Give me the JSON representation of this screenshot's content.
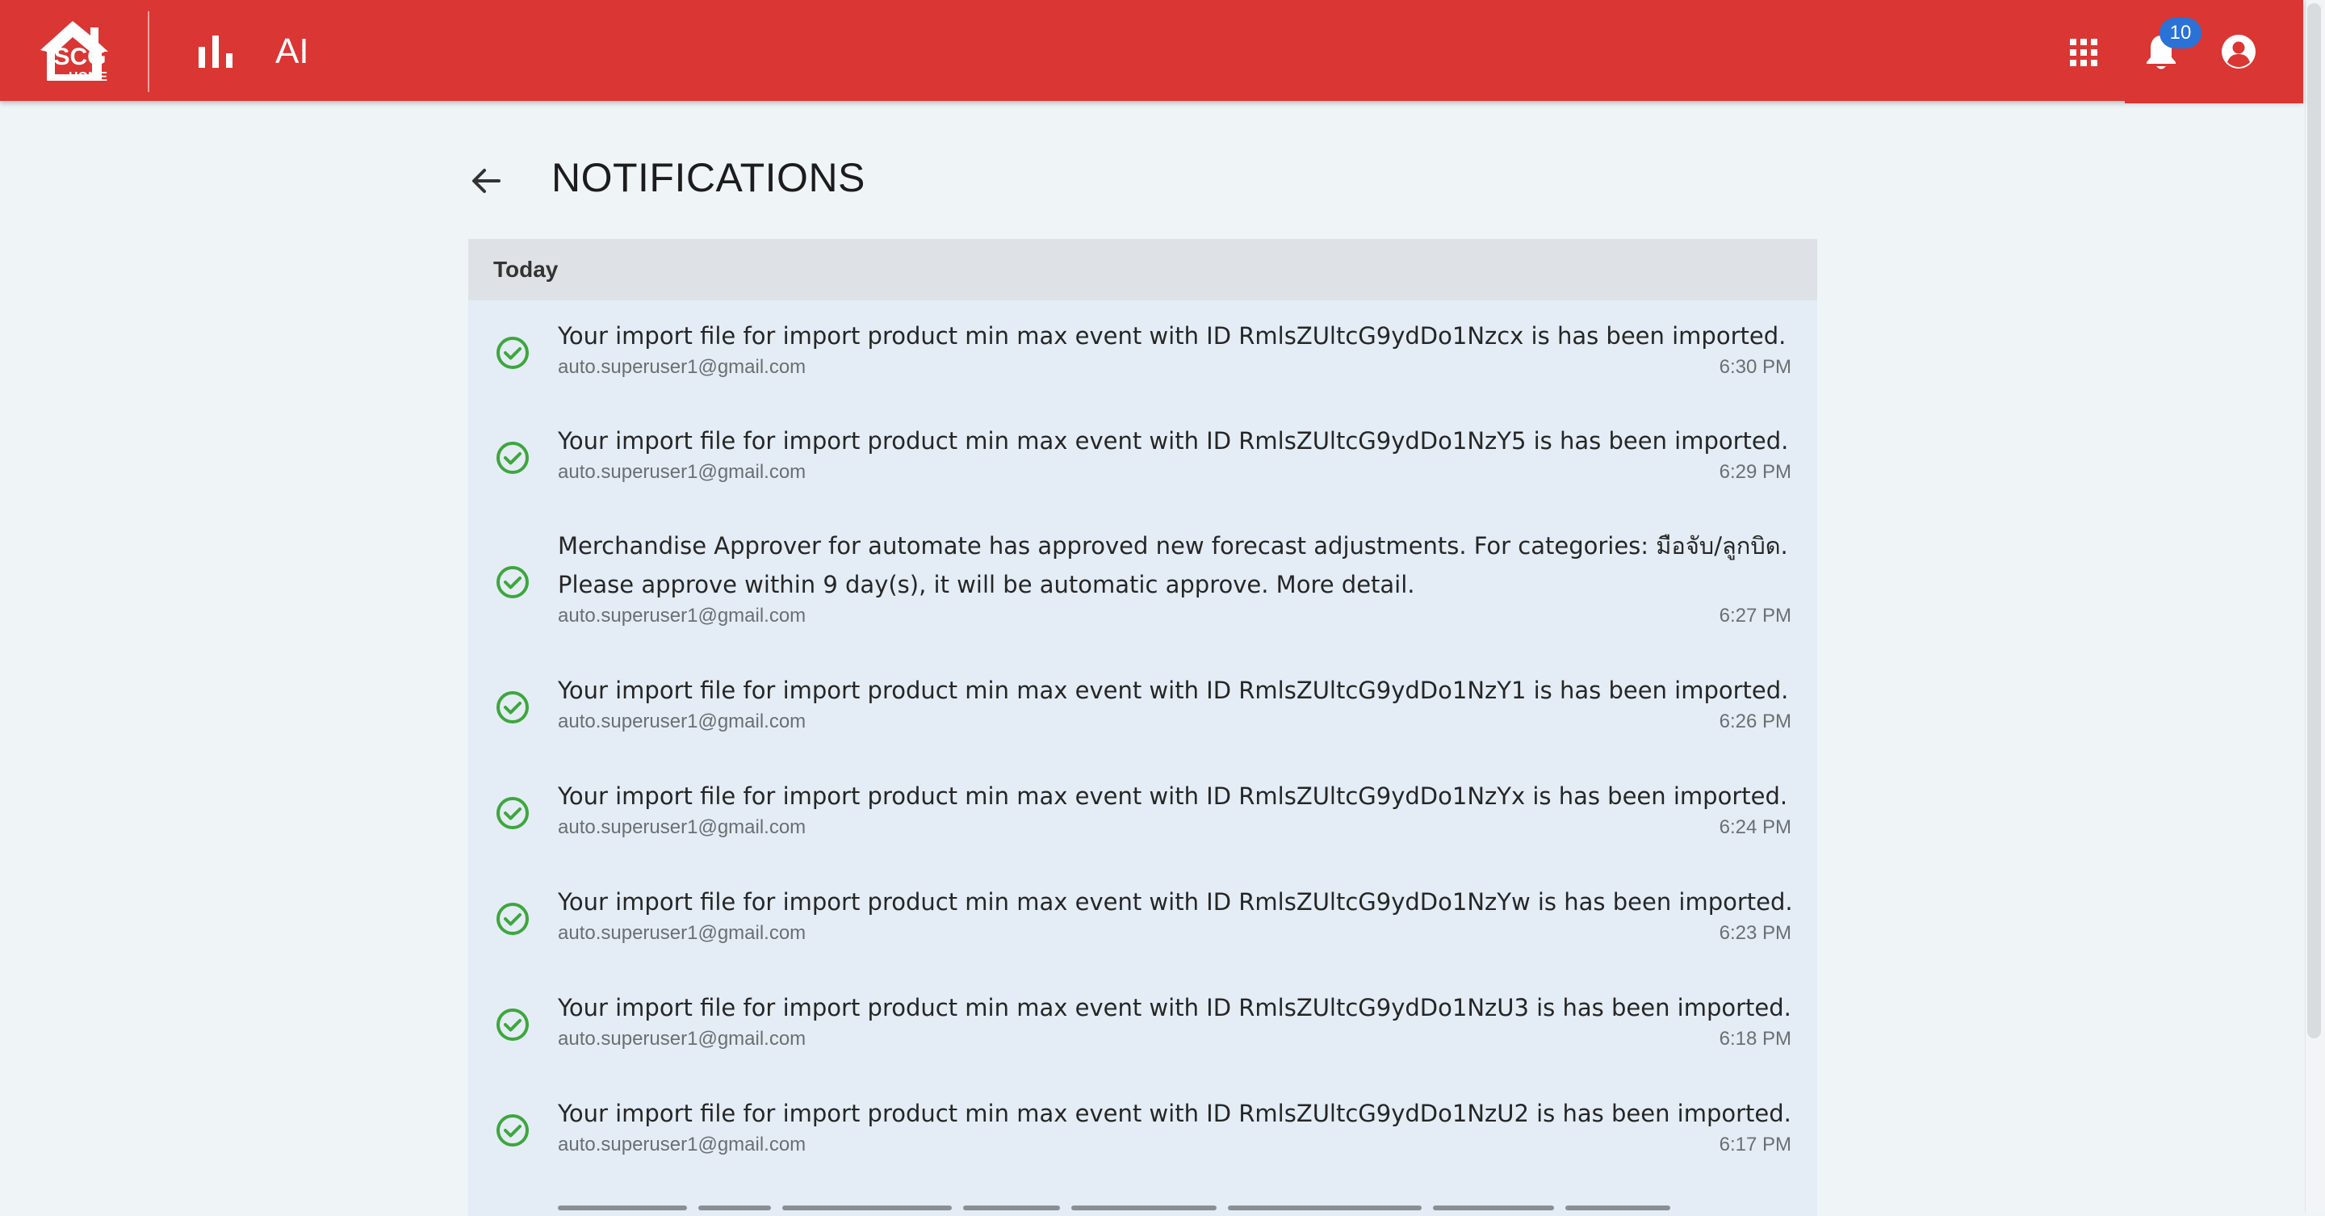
{
  "header": {
    "brand": "SCG",
    "brand_sub": "HOME",
    "app_title": "AI",
    "notification_count": "10",
    "accent_color": "#da3633",
    "badge_color": "#2a72d6"
  },
  "page": {
    "title": "NOTIFICATIONS"
  },
  "notifications": {
    "section_label": "Today",
    "status_icon": "check-circle-icon",
    "status_color": "#3ea63e",
    "items": [
      {
        "message": "Your import file for import product min max event with ID RmlsZUltcG9ydDo1Nzcx is has been imported.",
        "user": "auto.superuser1@gmail.com",
        "time": "6:30 PM"
      },
      {
        "message": "Your import file for import product min max event with ID RmlsZUltcG9ydDo1NzY5 is has been imported.",
        "user": "auto.superuser1@gmail.com",
        "time": "6:29 PM"
      },
      {
        "message": "Merchandise Approver for automate has approved new forecast adjustments. For categories: มือจับ/ลูกบิด.",
        "message_line2": "Please approve within 9 day(s), it will be automatic approve. More detail.",
        "user": "auto.superuser1@gmail.com",
        "time": "6:27 PM"
      },
      {
        "message": "Your import file for import product min max event with ID RmlsZUltcG9ydDo1NzY1 is has been imported.",
        "user": "auto.superuser1@gmail.com",
        "time": "6:26 PM"
      },
      {
        "message": "Your import file for import product min max event with ID RmlsZUltcG9ydDo1NzYx is has been imported.",
        "user": "auto.superuser1@gmail.com",
        "time": "6:24 PM"
      },
      {
        "message": "Your import file for import product min max event with ID RmlsZUltcG9ydDo1NzYw is has been imported.",
        "user": "auto.superuser1@gmail.com",
        "time": "6:23 PM"
      },
      {
        "message": "Your import file for import product min max event with ID RmlsZUltcG9ydDo1NzU3 is has been imported.",
        "user": "auto.superuser1@gmail.com",
        "time": "6:18 PM"
      },
      {
        "message": "Your import file for import product min max event with ID RmlsZUltcG9ydDo1NzU2 is has been imported.",
        "user": "auto.superuser1@gmail.com",
        "time": "6:17 PM"
      }
    ]
  }
}
